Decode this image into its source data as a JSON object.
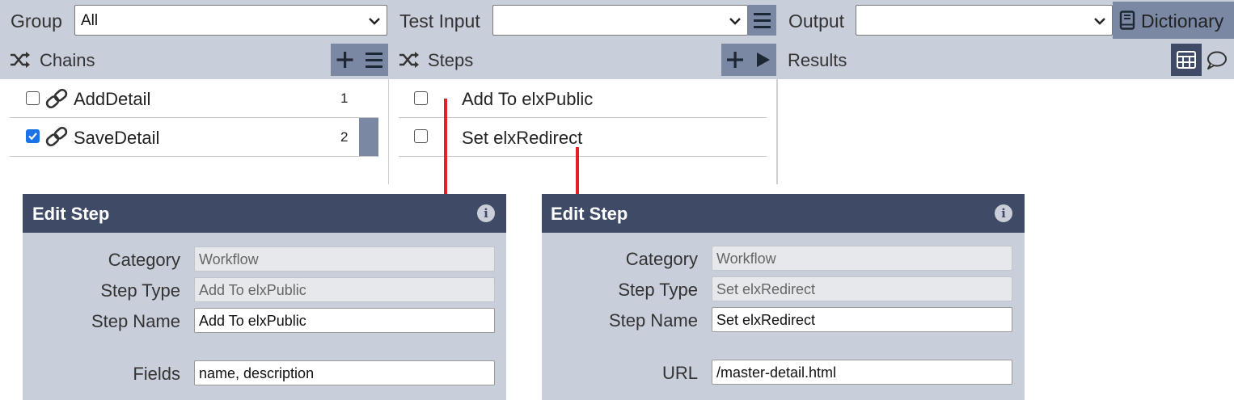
{
  "toolbar": {
    "group_label": "Group",
    "group_value": "All",
    "test_input_label": "Test Input",
    "test_input_value": "",
    "output_label": "Output",
    "output_value": "",
    "dictionary_label": "Dictionary"
  },
  "chains": {
    "title": "Chains",
    "items": [
      {
        "label": "AddDetail",
        "number": "1",
        "checked": false
      },
      {
        "label": "SaveDetail",
        "number": "2",
        "checked": true
      }
    ]
  },
  "steps": {
    "title": "Steps",
    "items": [
      {
        "label": "Add To elxPublic",
        "checked": false
      },
      {
        "label": "Set elxRedirect",
        "checked": false
      }
    ]
  },
  "results": {
    "title": "Results"
  },
  "edit_panels": [
    {
      "title": "Edit Step",
      "category_label": "Category",
      "category_value": "Workflow",
      "step_type_label": "Step Type",
      "step_type_value": "Add To elxPublic",
      "step_name_label": "Step Name",
      "step_name_value": "Add To elxPublic",
      "extra_label": "Fields",
      "extra_value": "name, description"
    },
    {
      "title": "Edit Step",
      "category_label": "Category",
      "category_value": "Workflow",
      "step_type_label": "Step Type",
      "step_type_value": "Set elxRedirect",
      "step_name_label": "Step Name",
      "step_name_value": "Set elxRedirect",
      "extra_label": "URL",
      "extra_value": "/master-detail.html"
    }
  ],
  "colors": {
    "toolbar_bg": "#c8ceda",
    "button_bg": "#7b88a4",
    "panel_header": "#3f4b66",
    "connector": "#e0202a",
    "checkbox_on": "#1a73e8"
  }
}
